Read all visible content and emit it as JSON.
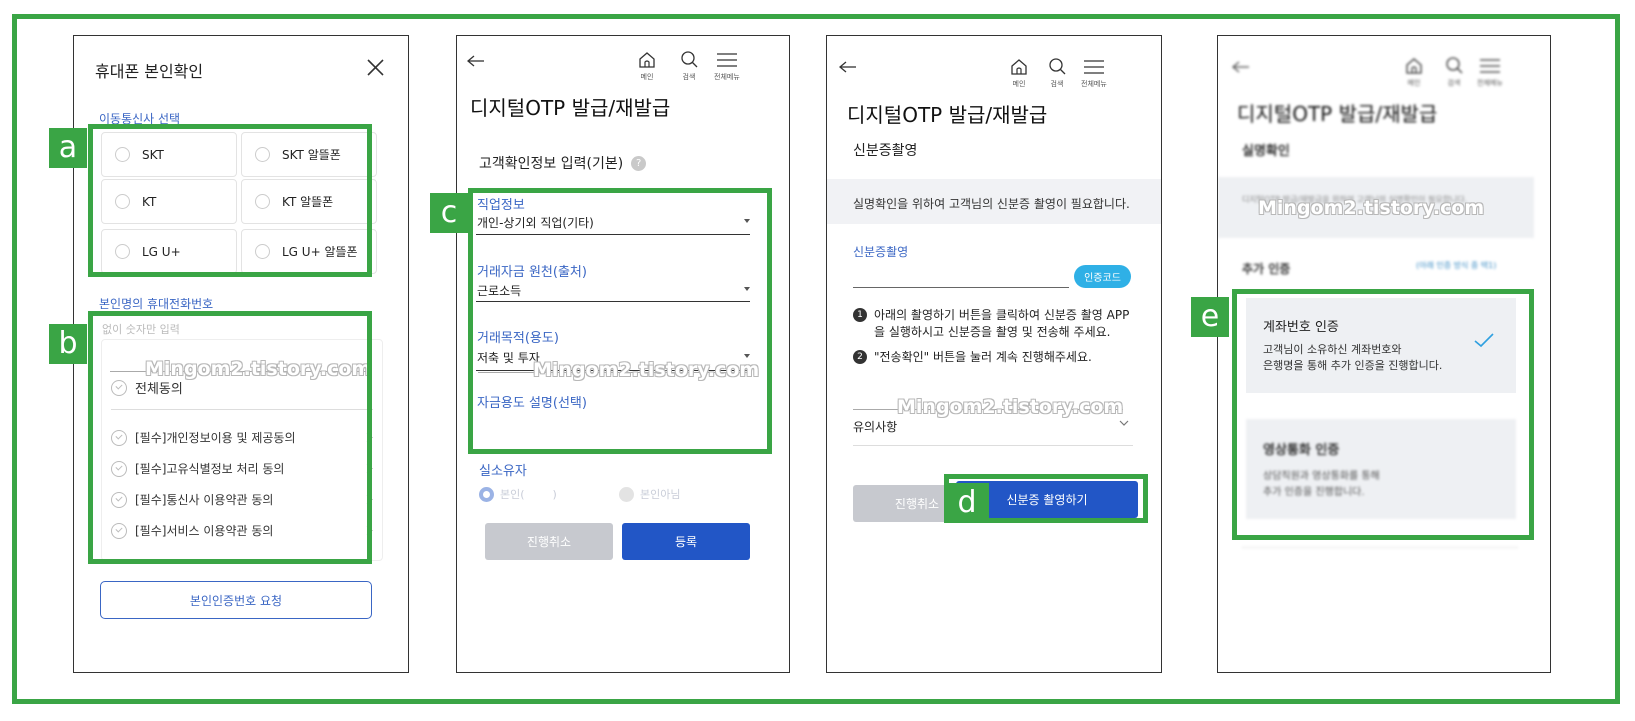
{
  "screen1": {
    "title": "휴대폰 본인확인",
    "carrier_label": "이동통신사 선택",
    "carriers": [
      "SKT",
      "SKT 알뜰폰",
      "KT",
      "KT 알뜰폰",
      "LG U+",
      "LG U+ 알뜰폰"
    ],
    "phone_label": "본인명의 휴대전화번호",
    "phone_placeholder": "없이 숫자만 입력",
    "agree_all": "전체동의",
    "agreements": [
      "[필수]개인정보이용 및 제공동의",
      "[필수]고유식별정보 처리 동의",
      "[필수]통신사 이용약관 동의",
      "[필수]서비스 이용약관 동의"
    ],
    "request_button": "본인인증번호 요청"
  },
  "header": {
    "home": "메인",
    "search": "검색",
    "menu": "전체메뉴"
  },
  "screen2": {
    "title": "디지털OTP 발급/재발급",
    "section": "고객확인정보 입력(기본)",
    "fields": [
      {
        "label": "직업정보",
        "value": "개인-상기외 직업(기타)"
      },
      {
        "label": "거래자금 원천(출처)",
        "value": "근로소득"
      },
      {
        "label": "거래목적(용도)",
        "value": "저축 및 투자"
      }
    ],
    "fund_desc_label": "자금용도 설명(선택)",
    "owner_label": "실소유자",
    "owner_opt1": "본인(",
    "owner_opt1_end": ")",
    "owner_opt2": "본인아님",
    "cancel": "진행취소",
    "submit": "등록"
  },
  "screen3": {
    "title": "디지털OTP 발급/재발급",
    "section": "신분증촬영",
    "notice": "실명확인을 위하여 고객님의 신분증 촬영이 필요합니다.",
    "field_label": "신분증촬영",
    "code_button": "인증코드",
    "step1": "아래의 촬영하기 버튼을 클릭하여 신분증 촬영 APP을 실행하시고 신분증을 촬영 및 전송해 주세요.",
    "step2": "\"전송확인\" 버튼을 눌러 계속 진행해주세요.",
    "caution": "유의사항",
    "cancel": "진행취소",
    "capture": "신분증 촬영하기"
  },
  "screen4": {
    "title": "디지털OTP 발급/재발급",
    "section": "실명확인",
    "blur_notice": "디지털OTP 발급/재발급을 위하여 고객님의 실명확인이 필요합니다.",
    "extra_label": "추가 인증",
    "extra_link": "(아래 인증 방식 중 택1)",
    "option1_title": "계좌번호 인증",
    "option1_desc1": "고객님이 소유하신 계좌번호와",
    "option1_desc2": "은행명을 통해 추가 인증을 진행합니다.",
    "option2_title": "영상통화 인증",
    "option2_desc1": "상담직원과 영상통화를 통해",
    "option2_desc2": "추가 인증을 진행합니다."
  },
  "tags": {
    "a": "a",
    "b": "b",
    "c": "c",
    "d": "d",
    "e": "e"
  },
  "watermark": "Mingom2.tistory.com",
  "colors": {
    "highlight": "#3aa545",
    "primary": "#2256c6",
    "link": "#3a66c4"
  }
}
